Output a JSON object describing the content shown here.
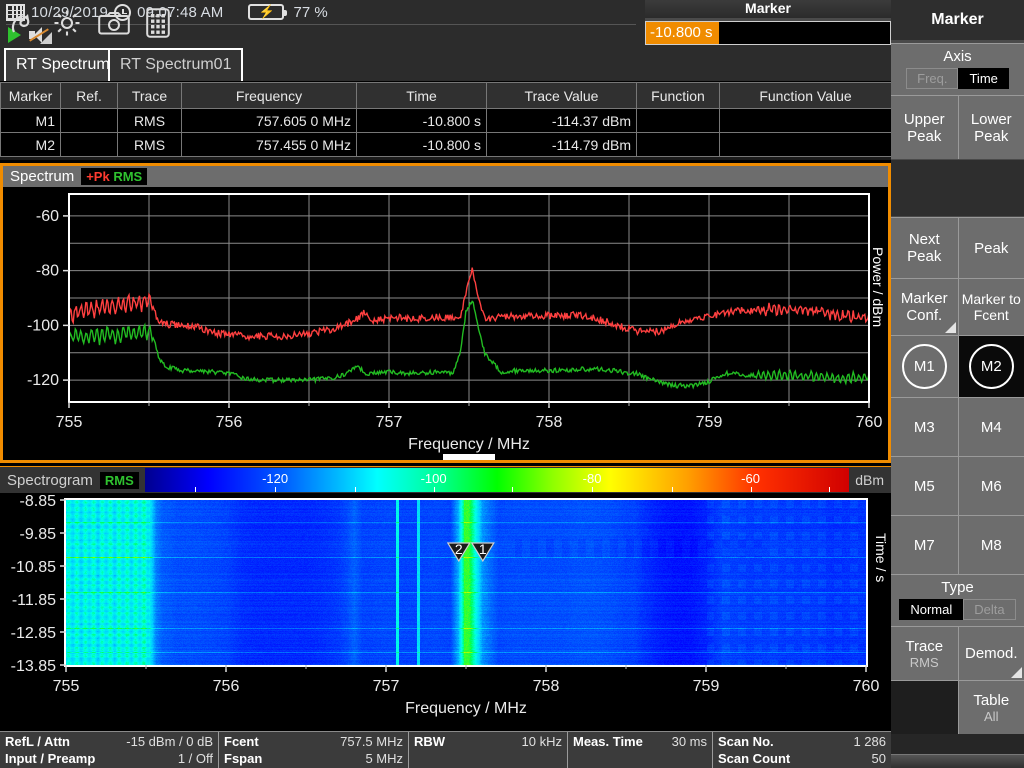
{
  "topbar": {
    "date": "10/29/2019",
    "time": "09:07:48 AM",
    "battery": "77 %",
    "calendar_icon": "calendar-icon",
    "clock_icon": "clock-icon",
    "battery_icon": "battery-charging-icon",
    "play_icon": "play-icon",
    "mute_icon": "speaker-muted-icon",
    "undo_icon": "undo-arrow-icon",
    "settings_icon": "gear-icon",
    "camera_icon": "camera-icon",
    "keypad_icon": "keypad-icon"
  },
  "marker_box": {
    "title": "Marker",
    "value": "-10.800 s"
  },
  "tabs": [
    {
      "label": "RT Spectrum",
      "active": true
    },
    {
      "label": "RT Spectrum01",
      "active": false
    }
  ],
  "marker_table": {
    "headers": [
      "Marker",
      "Ref.",
      "Trace",
      "Frequency",
      "Time",
      "Trace Value",
      "Function",
      "Function Value"
    ],
    "rows": [
      {
        "marker": "M1",
        "ref": "",
        "trace": "RMS",
        "frequency": "757.605 0 MHz",
        "time": "-10.800 s",
        "trace_value": "-114.37 dBm",
        "function": "",
        "function_value": ""
      },
      {
        "marker": "M2",
        "ref": "",
        "trace": "RMS",
        "frequency": "757.455 0 MHz",
        "time": "-10.800 s",
        "trace_value": "-114.79 dBm",
        "function": "",
        "function_value": ""
      }
    ]
  },
  "spectrum": {
    "title": "Spectrum",
    "badge_peak": "+Pk",
    "badge_rms": "RMS",
    "xlabel": "Frequency / MHz",
    "ylabel": "Power / dBm",
    "xticks": [
      "755",
      "756",
      "757",
      "758",
      "759",
      "760"
    ],
    "yticks": [
      "-60",
      "-80",
      "-100",
      "-120"
    ]
  },
  "spectrogram": {
    "title": "Spectrogram",
    "badge": "RMS",
    "unit": "dBm",
    "colorbar_ticks": [
      "-120",
      "-100",
      "-80",
      "-60"
    ],
    "xlabel": "Frequency / MHz",
    "ylabel": "Time / s",
    "xticks": [
      "755",
      "756",
      "757",
      "758",
      "759",
      "760"
    ],
    "yticks": [
      "-8.85",
      "-9.85",
      "-10.85",
      "-11.85",
      "-12.85",
      "-13.85"
    ],
    "markers": [
      "2",
      "1"
    ]
  },
  "status": [
    {
      "k1": "RefL / Attn",
      "v1": "-15 dBm / 0 dB",
      "k2": "Input / Preamp",
      "v2": "1 / Off"
    },
    {
      "k1": "Fcent",
      "v1": "757.5 MHz",
      "k2": "Fspan",
      "v2": "5 MHz"
    },
    {
      "k1": "RBW",
      "v1": "10 kHz",
      "k2": "",
      "v2": ""
    },
    {
      "k1": "Meas. Time",
      "v1": "30 ms",
      "k2": "",
      "v2": ""
    },
    {
      "k1": "Scan No.",
      "v1": "1 286",
      "k2": "Scan Count",
      "v2": "50"
    }
  ],
  "sidebar": {
    "title": "Marker",
    "axis": {
      "label": "Axis",
      "options": [
        "Freq.",
        "Time"
      ],
      "selected": "Time"
    },
    "peak_row": [
      "Upper Peak",
      "Lower Peak"
    ],
    "nav_row": [
      "Next Peak",
      "Peak"
    ],
    "conf_row": [
      "Marker Conf.",
      "Marker to Fcent"
    ],
    "markers": [
      {
        "label": "M1",
        "selected": false
      },
      {
        "label": "M2",
        "selected": true
      },
      {
        "label": "M3",
        "selected": false
      },
      {
        "label": "M4",
        "selected": false
      },
      {
        "label": "M5",
        "selected": false
      },
      {
        "label": "M6",
        "selected": false
      },
      {
        "label": "M7",
        "selected": false
      },
      {
        "label": "M8",
        "selected": false
      }
    ],
    "type": {
      "label": "Type",
      "options": [
        "Normal",
        "Delta"
      ],
      "selected": "Normal"
    },
    "trace": {
      "label": "Trace",
      "value": "RMS"
    },
    "demod": {
      "label": "Demod."
    },
    "table": {
      "label": "Table",
      "value": "All"
    }
  },
  "chart_data": {
    "type": "line",
    "title": "Spectrum",
    "xlabel": "Frequency / MHz",
    "ylabel": "Power / dBm",
    "xlim": [
      755,
      760
    ],
    "ylim": [
      -128,
      -52
    ],
    "grid": true,
    "series": [
      {
        "name": "+Pk",
        "color": "#ff4040",
        "x": [
          755.0,
          755.05,
          755.1,
          755.15,
          755.2,
          755.25,
          755.3,
          755.35,
          755.4,
          755.45,
          755.5,
          755.52,
          755.55,
          755.6,
          755.7,
          755.8,
          755.9,
          756.0,
          756.1,
          756.2,
          756.3,
          756.4,
          756.5,
          756.6,
          756.7,
          756.75,
          756.8,
          756.85,
          756.9,
          756.95,
          757.0,
          757.05,
          757.1,
          757.2,
          757.3,
          757.4,
          757.45,
          757.48,
          757.52,
          757.55,
          757.6,
          757.65,
          757.7,
          757.8,
          757.9,
          758.0,
          758.1,
          758.15,
          758.25,
          758.35,
          758.45,
          758.55,
          758.6,
          758.7,
          758.8,
          758.9,
          759.0,
          759.1,
          759.2,
          759.3,
          759.4,
          759.5,
          759.6,
          759.7,
          759.8,
          759.9,
          760.0
        ],
        "y": [
          -96.5,
          -95.0,
          -94.5,
          -94.0,
          -93.5,
          -93.0,
          -92.5,
          -92.0,
          -92.0,
          -91.5,
          -91.0,
          -91.0,
          -98.5,
          -99.5,
          -100.0,
          -100.5,
          -102.5,
          -103.5,
          -104.0,
          -104.0,
          -104.0,
          -103.5,
          -103.0,
          -102.0,
          -100.5,
          -99.0,
          -97.5,
          -95.0,
          -98.5,
          -98.0,
          -97.5,
          -97.0,
          -97.5,
          -97.5,
          -97.0,
          -97.5,
          -97.0,
          -88.0,
          -79.5,
          -88.0,
          -97.0,
          -97.5,
          -97.0,
          -96.5,
          -96.5,
          -96.5,
          -96.5,
          -96.0,
          -97.0,
          -98.5,
          -100.5,
          -102.0,
          -102.5,
          -102.0,
          -99.5,
          -97.5,
          -96.5,
          -95.5,
          -94.5,
          -94.5,
          -94.0,
          -94.0,
          -94.5,
          -95.0,
          -96.5,
          -97.0,
          -96.5
        ]
      },
      {
        "name": "RMS",
        "color": "#22bb22",
        "x": [
          755.0,
          755.05,
          755.1,
          755.15,
          755.2,
          755.25,
          755.3,
          755.35,
          755.4,
          755.45,
          755.5,
          755.52,
          755.56,
          755.6,
          755.7,
          755.8,
          755.9,
          756.0,
          756.05,
          756.1,
          756.2,
          756.3,
          756.4,
          756.5,
          756.6,
          756.7,
          756.75,
          756.8,
          756.85,
          756.9,
          757.0,
          757.1,
          757.2,
          757.3,
          757.4,
          757.45,
          757.48,
          757.52,
          757.55,
          757.6,
          757.7,
          757.8,
          757.9,
          758.0,
          758.1,
          758.2,
          758.3,
          758.4,
          758.5,
          758.55,
          758.6,
          758.7,
          758.8,
          758.9,
          759.0,
          759.1,
          759.2,
          759.3,
          759.4,
          759.5,
          759.6,
          759.7,
          759.8,
          759.9,
          760.0
        ],
        "y": [
          -104.5,
          -103.5,
          -104.5,
          -103.0,
          -104.5,
          -103.0,
          -104.0,
          -102.5,
          -103.5,
          -102.5,
          -102.5,
          -102.5,
          -112.0,
          -115.0,
          -116.5,
          -116.5,
          -117.0,
          -117.5,
          -118.5,
          -119.5,
          -120.0,
          -120.0,
          -120.0,
          -120.0,
          -119.5,
          -118.5,
          -117.0,
          -114.5,
          -117.5,
          -117.5,
          -117.0,
          -117.5,
          -117.5,
          -117.0,
          -117.5,
          -108.5,
          -95.5,
          -90.5,
          -98.5,
          -110.5,
          -117.0,
          -116.5,
          -116.5,
          -116.5,
          -116.5,
          -116.0,
          -116.0,
          -116.5,
          -117.5,
          -117.5,
          -119.0,
          -121.0,
          -122.0,
          -122.0,
          -120.5,
          -117.5,
          -118.0,
          -118.5,
          -118.0,
          -118.5,
          -118.5,
          -118.5,
          -119.5,
          -119.0,
          -119.0
        ]
      }
    ]
  }
}
